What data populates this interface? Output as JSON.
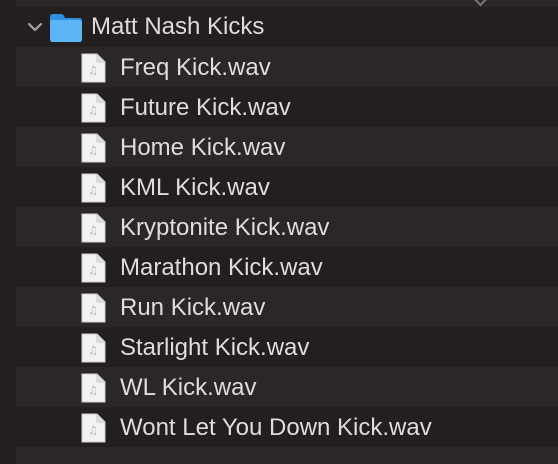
{
  "folder": {
    "name": "Matt Nash Kicks",
    "expanded": true,
    "icon": "folder-icon",
    "disclosure_icon": "chevron-down-icon"
  },
  "files": [
    {
      "name": "Freq Kick.wav",
      "icon": "audio-file-icon"
    },
    {
      "name": "Future Kick.wav",
      "icon": "audio-file-icon"
    },
    {
      "name": "Home Kick.wav",
      "icon": "audio-file-icon"
    },
    {
      "name": "KML Kick.wav",
      "icon": "audio-file-icon"
    },
    {
      "name": "Kryptonite Kick.wav",
      "icon": "audio-file-icon"
    },
    {
      "name": "Marathon Kick.wav",
      "icon": "audio-file-icon"
    },
    {
      "name": "Run Kick.wav",
      "icon": "audio-file-icon"
    },
    {
      "name": "Starlight Kick.wav",
      "icon": "audio-file-icon"
    },
    {
      "name": "WL Kick.wav",
      "icon": "audio-file-icon"
    },
    {
      "name": "Wont Let You Down Kick.wav",
      "icon": "audio-file-icon"
    }
  ],
  "colors": {
    "background": "#231f1e",
    "row_stripe": "#2b2726",
    "text": "#dfdcda",
    "folder_blue": "#4aa6f0"
  }
}
